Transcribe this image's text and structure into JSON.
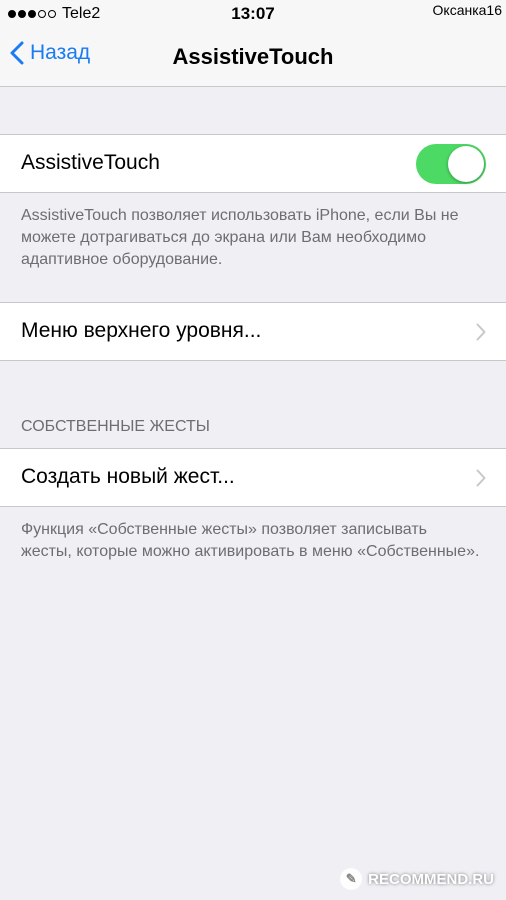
{
  "status_bar": {
    "carrier": "Tele2",
    "time": "13:07",
    "user_tag": "Оксанка16"
  },
  "nav": {
    "back_label": "Назад",
    "title": "AssistiveTouch"
  },
  "assistive_touch": {
    "label": "AssistiveTouch",
    "enabled": true,
    "description": "AssistiveTouch позволяет использовать iPhone, если Вы не можете дотрагиваться до экрана или Вам необходимо адаптивное оборудование."
  },
  "top_menu": {
    "label": "Меню верхнего уровня..."
  },
  "custom_gestures": {
    "header": "СОБСТВЕННЫЕ ЖЕСТЫ",
    "create_label": "Создать новый жест...",
    "description": "Функция «Собственные жесты» позволяет записывать жесты, которые можно активировать в меню «Собственные»."
  },
  "watermark": {
    "text": "RECOMMEND.RU"
  },
  "colors": {
    "accent": "#1a7bf2",
    "toggle_on": "#4cd964",
    "background": "#efeff4"
  }
}
